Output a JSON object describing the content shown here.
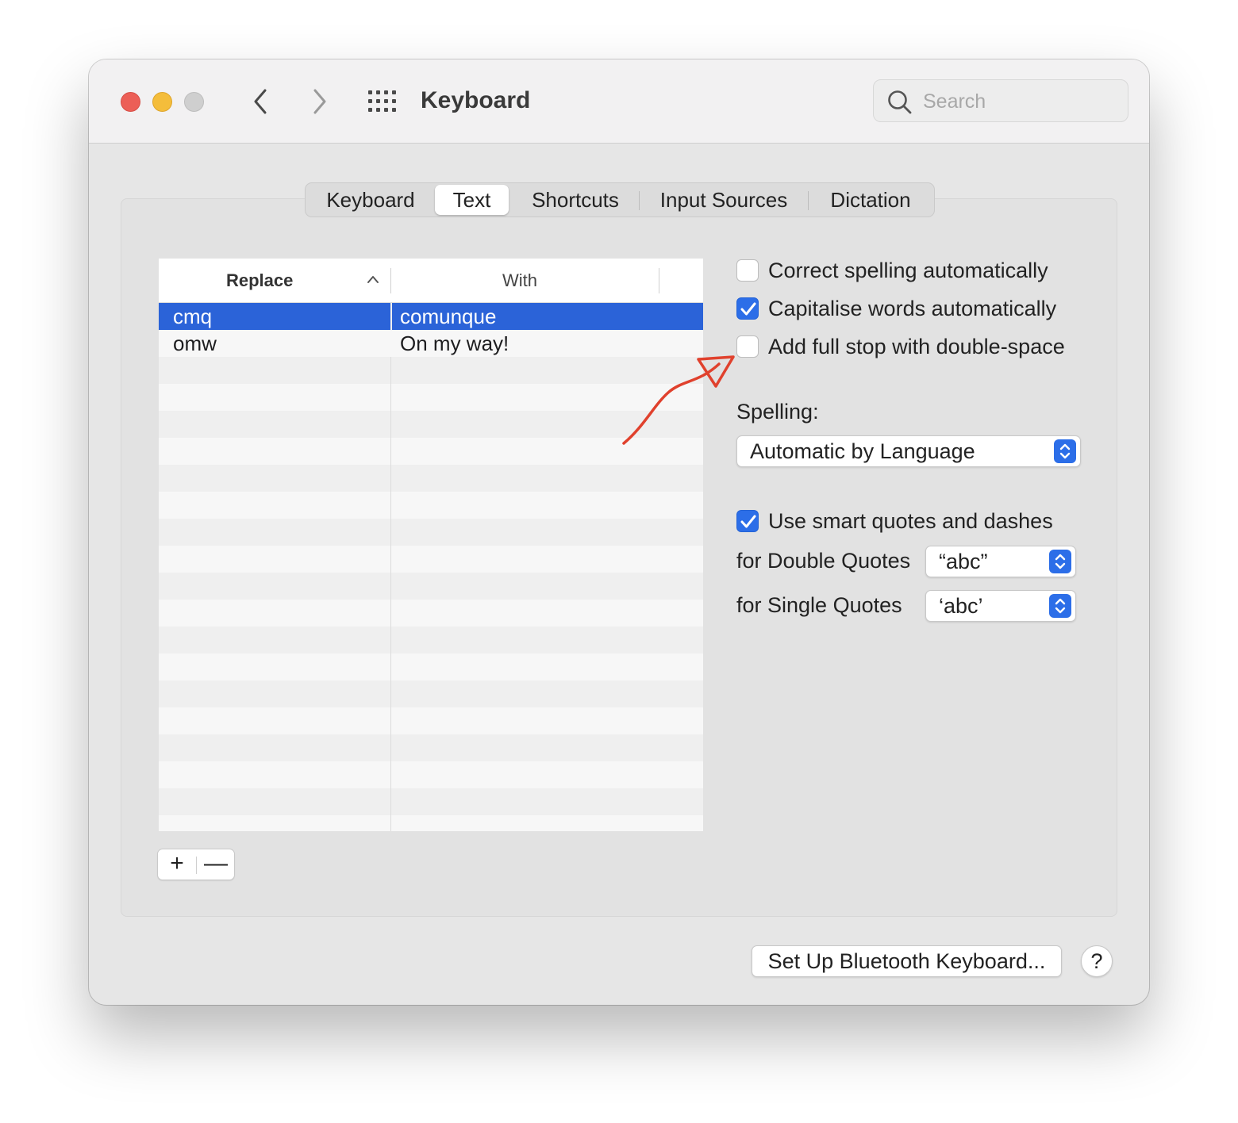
{
  "window": {
    "title": "Keyboard",
    "search": {
      "placeholder": "Search",
      "value": ""
    }
  },
  "tabs": [
    {
      "label": "Keyboard",
      "active": false
    },
    {
      "label": "Text",
      "active": true
    },
    {
      "label": "Shortcuts",
      "active": false
    },
    {
      "label": "Input Sources",
      "active": false
    },
    {
      "label": "Dictation",
      "active": false
    }
  ],
  "replacements": {
    "headers": {
      "replace": "Replace",
      "with": "With"
    },
    "sort": "ascending",
    "rows": [
      {
        "replace": "cmq",
        "with": "comunque",
        "selected": true
      },
      {
        "replace": "omw",
        "with": "On my way!",
        "selected": false
      }
    ],
    "add_label": "+",
    "remove_label": "—"
  },
  "options": {
    "correct_spelling": {
      "label": "Correct spelling automatically",
      "checked": false
    },
    "capitalise_words": {
      "label": "Capitalise words automatically",
      "checked": true
    },
    "full_stop": {
      "label": "Add full stop with double-space",
      "checked": false
    },
    "spelling_label": "Spelling:",
    "spelling_value": "Automatic by Language",
    "smart_quotes": {
      "label": "Use smart quotes and dashes",
      "checked": true
    },
    "double_quotes_label": "for Double Quotes",
    "double_quotes_value": "“abc”",
    "single_quotes_label": "for Single Quotes",
    "single_quotes_value": "‘abc’"
  },
  "footer": {
    "bluetooth_button": "Set Up Bluetooth Keyboard...",
    "help_button": "?"
  },
  "colors": {
    "accent": "#2c6ee8",
    "selection": "#2b63d8",
    "annotation_arrow": "#e0412d",
    "close": "#ec5f57",
    "minimize": "#f4bd3b",
    "zoom_disabled": "#cfcfcf"
  },
  "icons": [
    "back-chevron-icon",
    "forward-chevron-icon",
    "grid-icon",
    "search-icon",
    "sort-ascending-icon",
    "checkmark-icon",
    "stepper-icon",
    "annotation-arrow"
  ]
}
